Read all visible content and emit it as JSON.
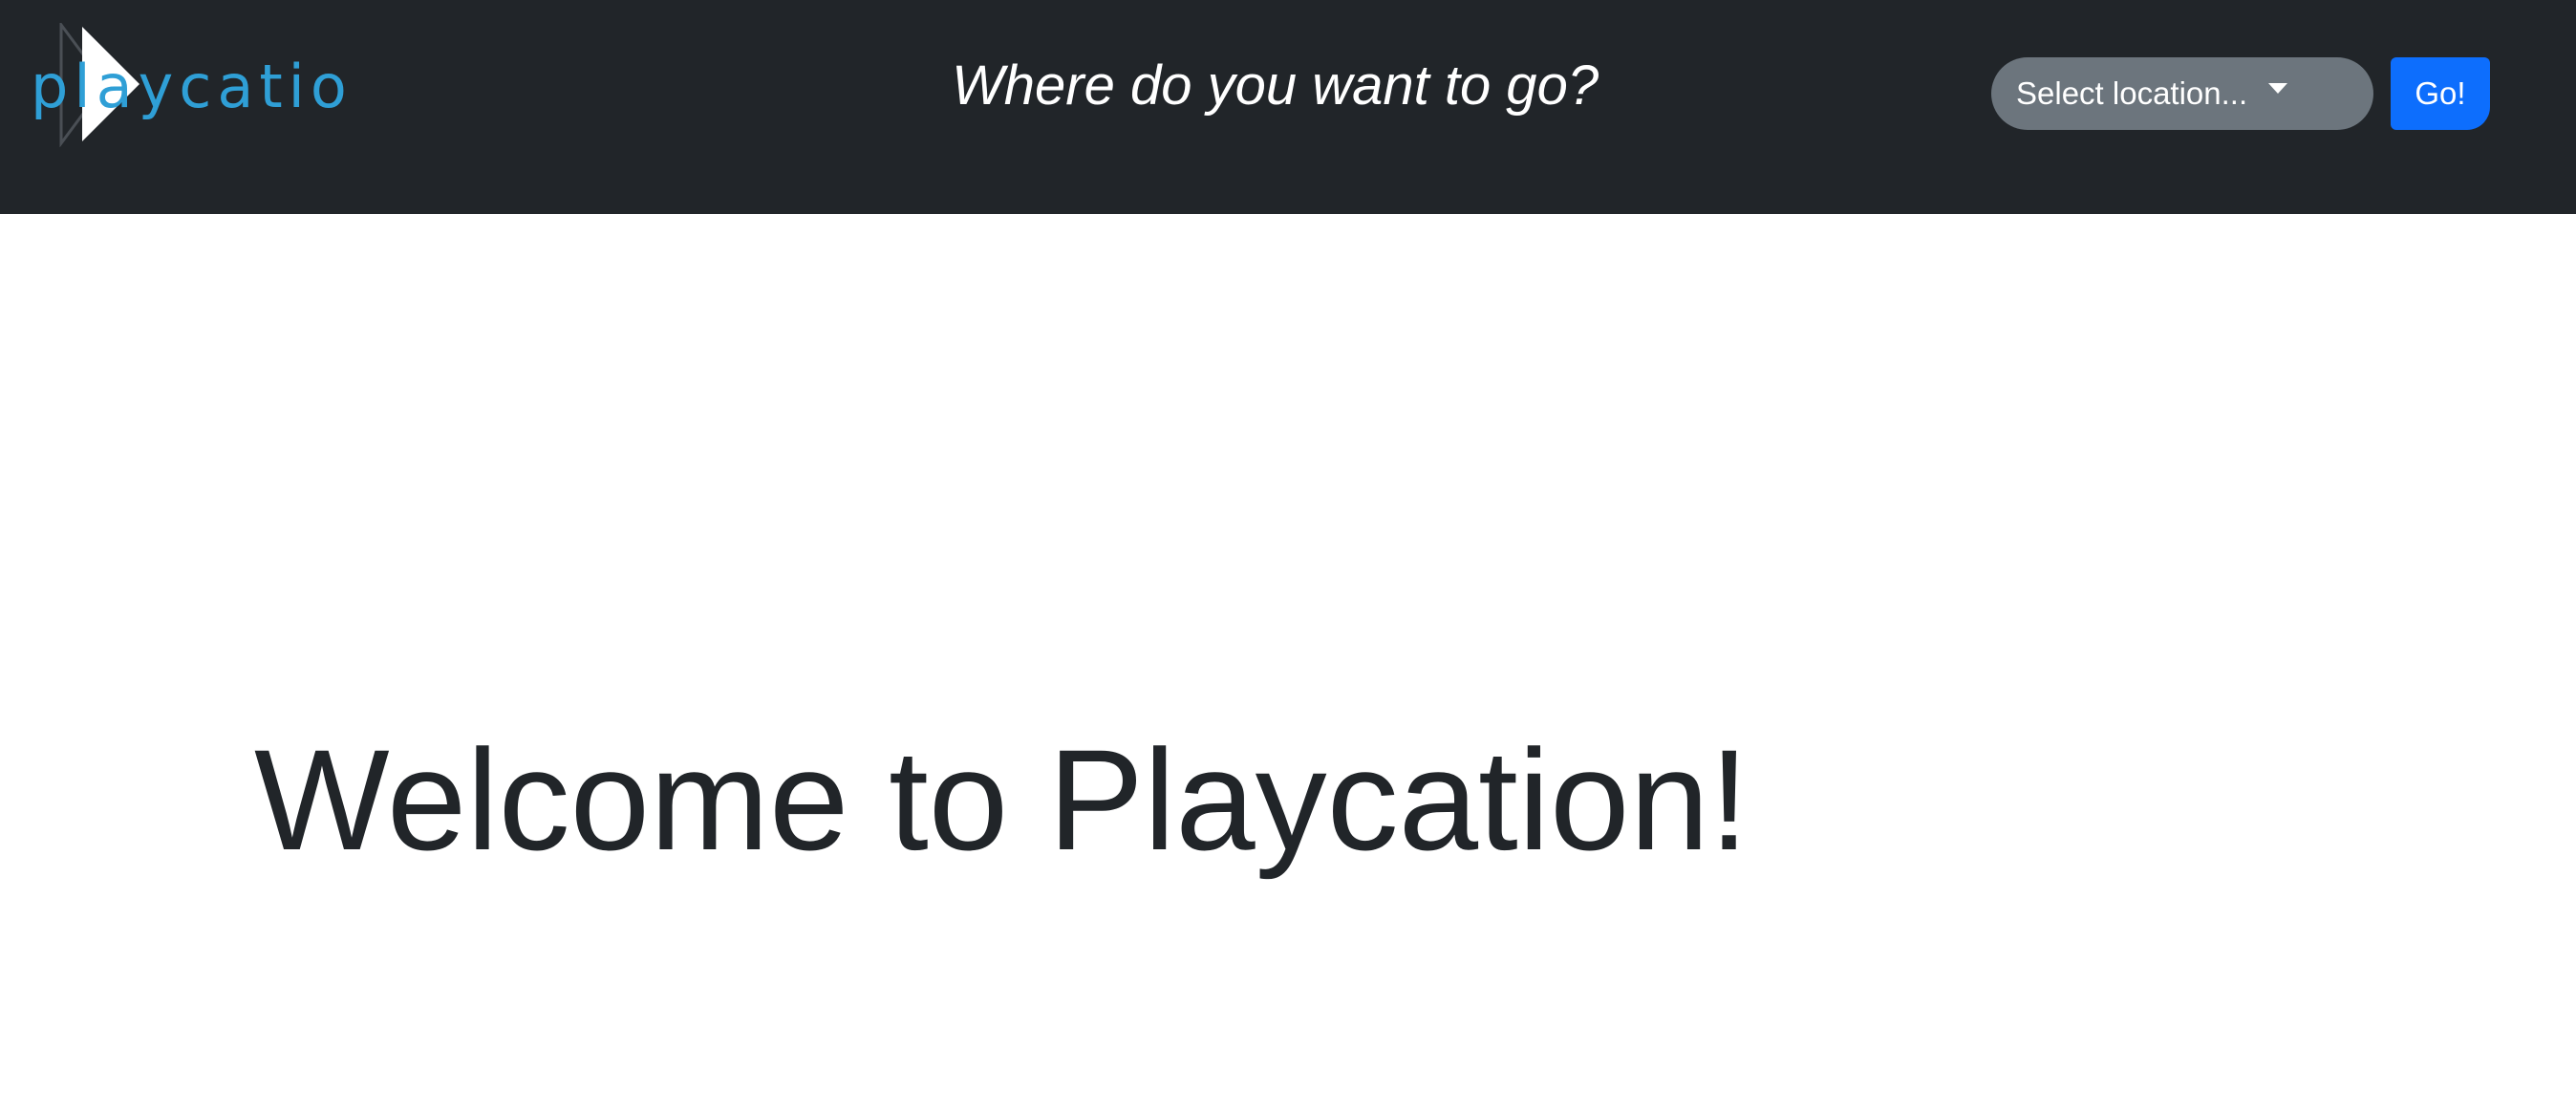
{
  "navbar": {
    "logo_text": "playcation",
    "logo_icon": "play-triangle-icon",
    "tagline": "Where do you want to go?",
    "location_select": {
      "selected_label": "Select location...",
      "caret_icon": "caret-down-icon"
    },
    "go_button_label": "Go!"
  },
  "main": {
    "heading": "Welcome to Playcation!"
  },
  "colors": {
    "navbar_bg": "#212529",
    "logo_text": "#2f9fd6",
    "select_bg": "#6c757d",
    "go_button_bg": "#0d6efd",
    "heading_text": "#212529"
  }
}
